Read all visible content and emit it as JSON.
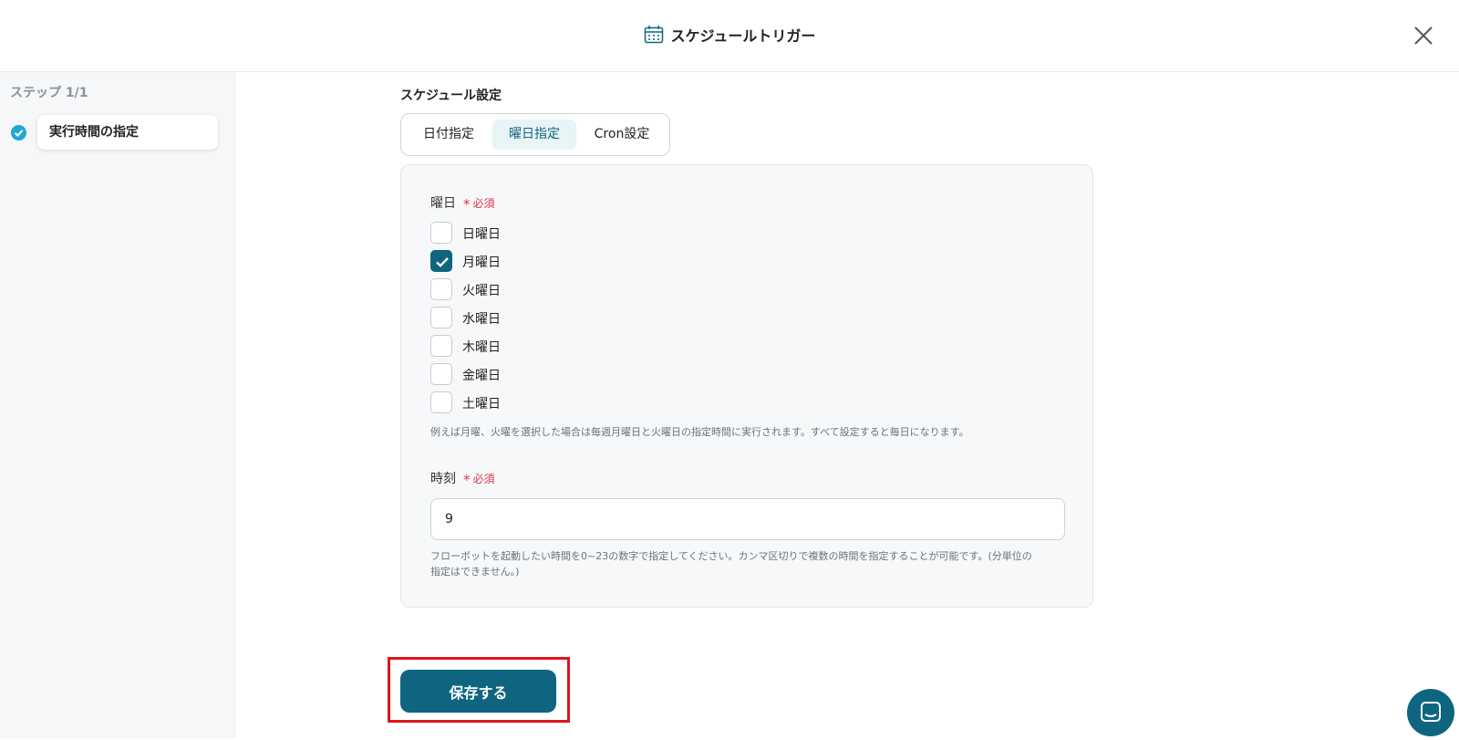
{
  "header": {
    "title": "スケジュールトリガー",
    "icon": "calendar-icon",
    "close_icon": "close-icon"
  },
  "sidebar": {
    "step_label": "ステップ 1/1",
    "steps": [
      {
        "label": "実行時間の指定",
        "status": "completed"
      }
    ]
  },
  "main": {
    "section_title": "スケジュール設定",
    "tabs": [
      {
        "label": "日付指定",
        "active": false
      },
      {
        "label": "曜日指定",
        "active": true
      },
      {
        "label": "Cron設定",
        "active": false
      }
    ],
    "weekday_field": {
      "label": "曜日",
      "required_text": "必須",
      "options": [
        {
          "label": "日曜日",
          "checked": false
        },
        {
          "label": "月曜日",
          "checked": true
        },
        {
          "label": "火曜日",
          "checked": false
        },
        {
          "label": "水曜日",
          "checked": false
        },
        {
          "label": "木曜日",
          "checked": false
        },
        {
          "label": "金曜日",
          "checked": false
        },
        {
          "label": "土曜日",
          "checked": false
        }
      ],
      "hint": "例えば月曜、火曜を選択した場合は毎週月曜日と火曜日の指定時間に実行されます。すべて設定すると毎日になります。"
    },
    "time_field": {
      "label": "時刻",
      "required_text": "必須",
      "value": "9",
      "hint_line1": "フローボットを起動したい時間を0~23の数字で指定してください。カンマ区切りで複数の時間を指定することが可能です。(分単位の",
      "hint_line2": "指定はできません。)"
    },
    "save_label": "保存する"
  },
  "colors": {
    "primary": "#0f6580",
    "required": "#e0354b",
    "highlight": "#e0141c",
    "step_check": "#1ea8d4"
  },
  "chat_icon": "chat-icon"
}
